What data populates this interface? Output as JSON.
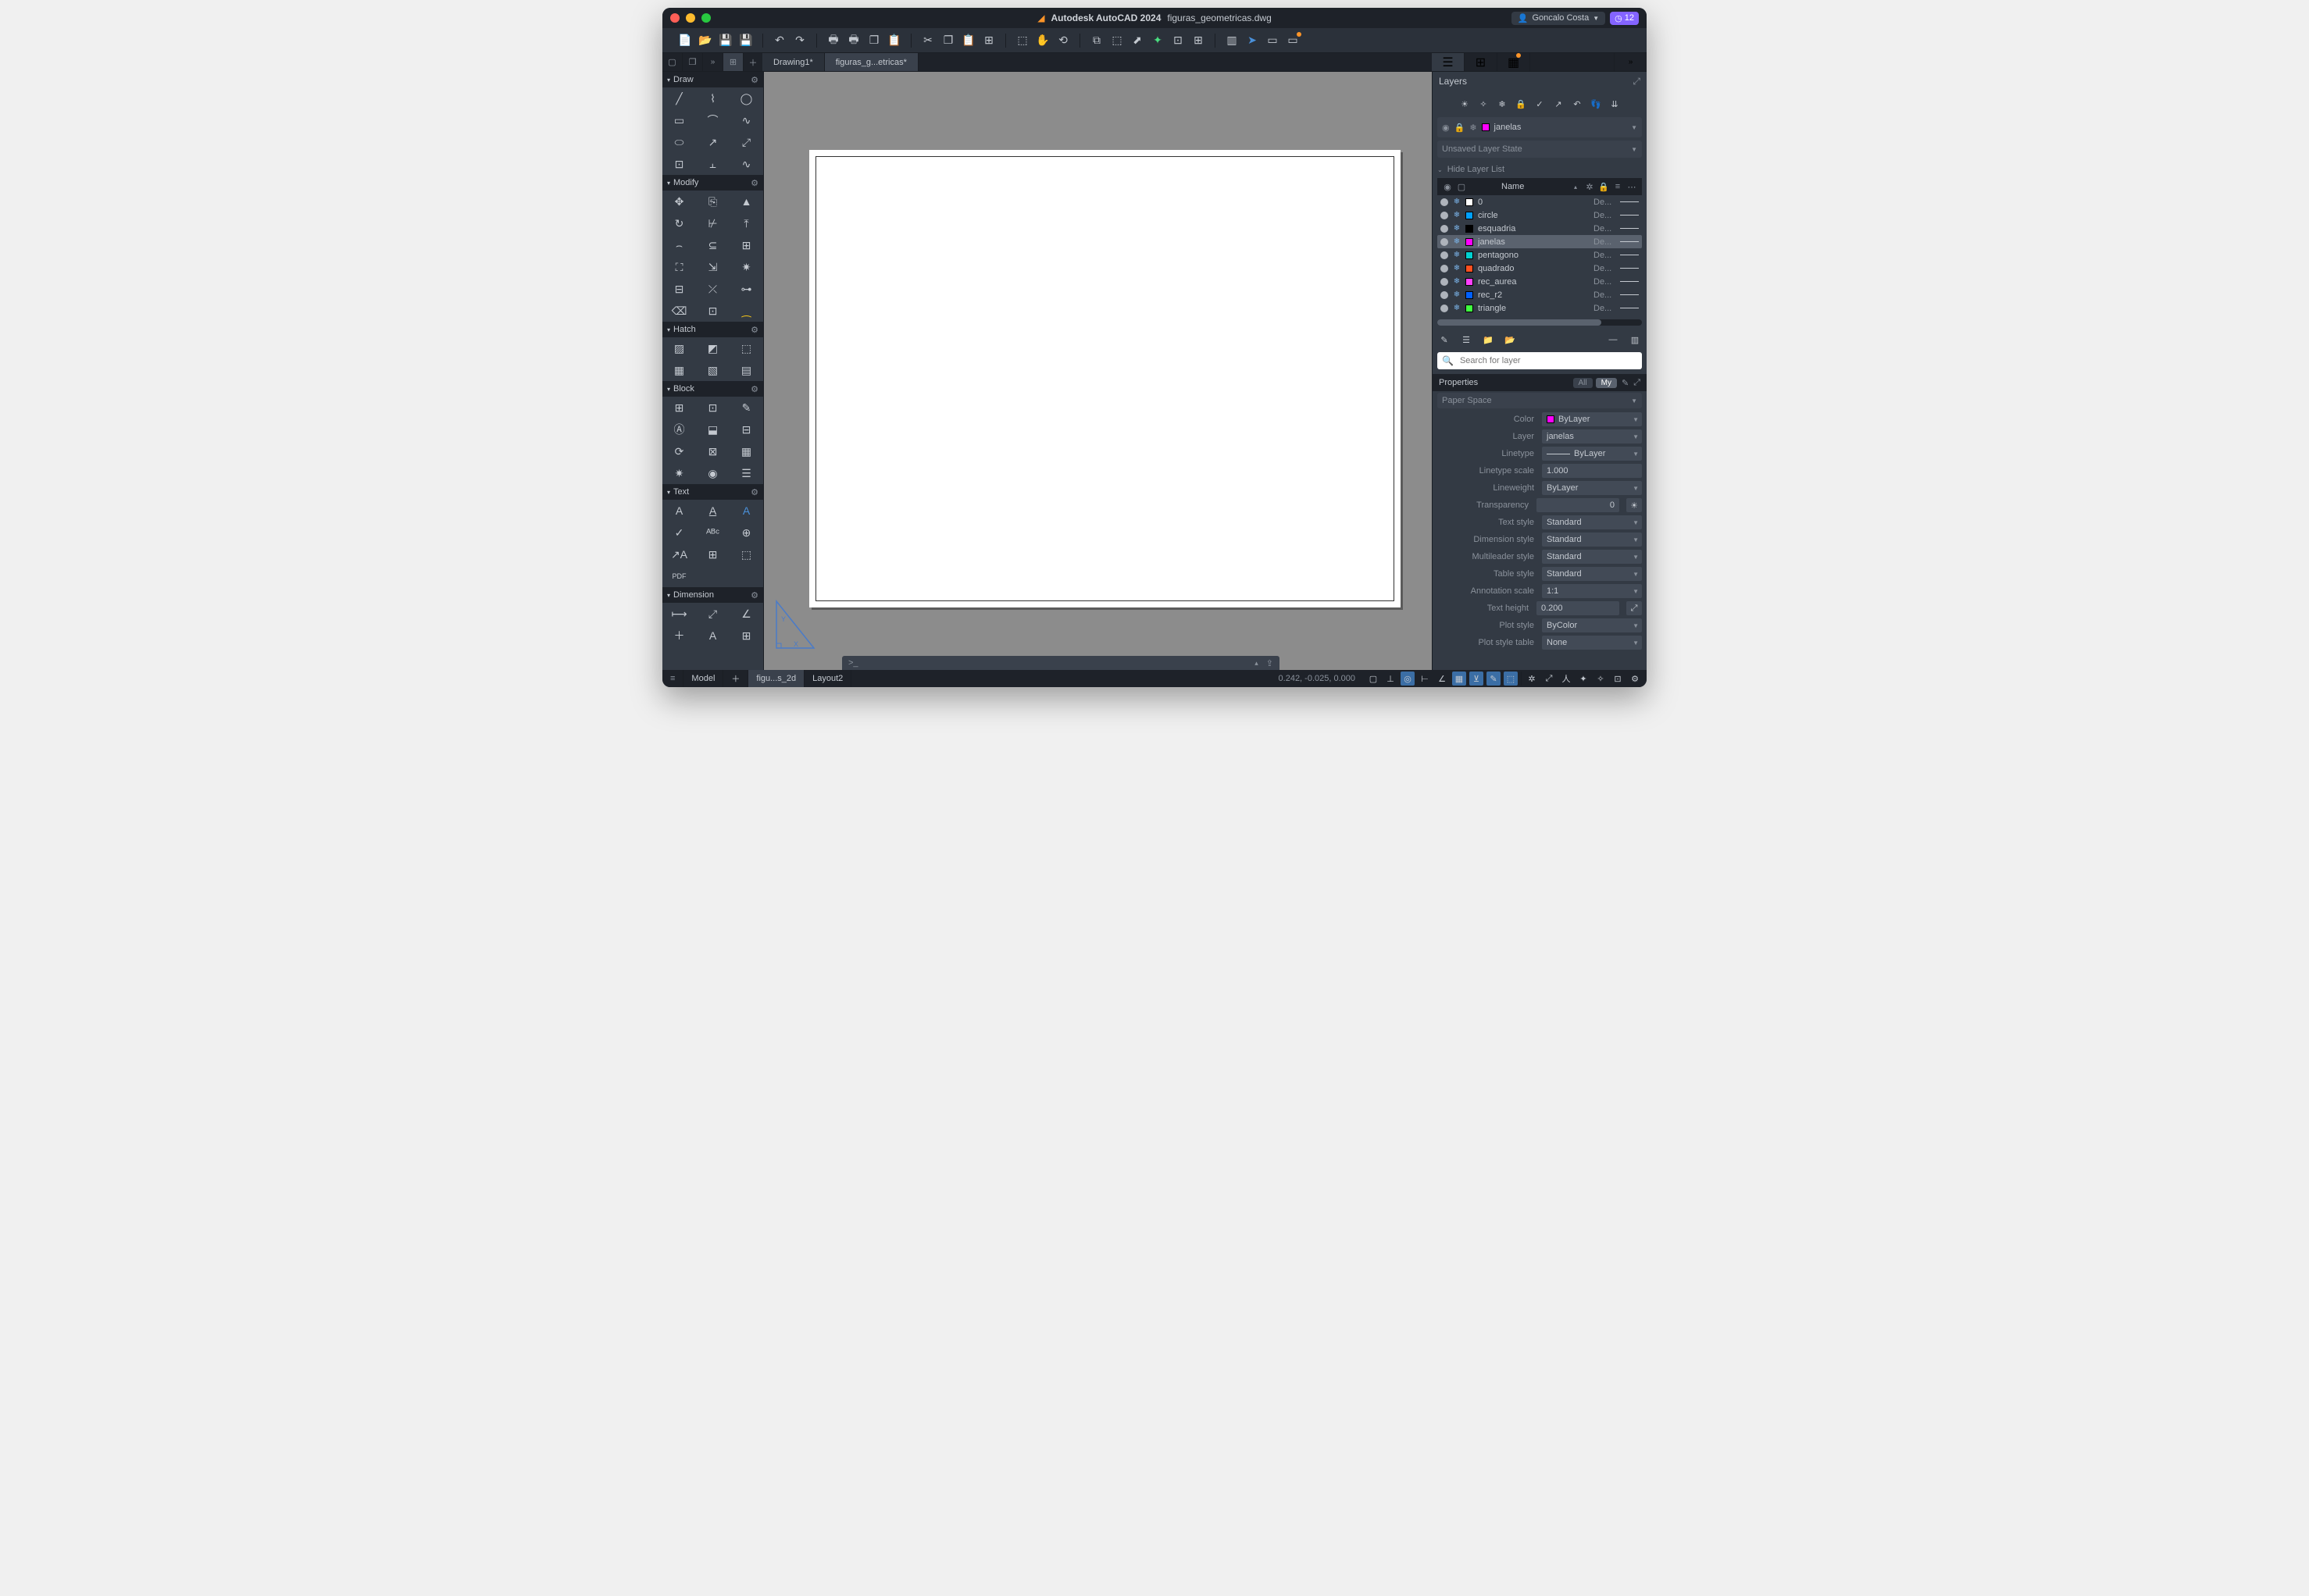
{
  "title": {
    "app": "Autodesk AutoCAD 2024",
    "doc": "figuras_geometricas.dwg"
  },
  "user": {
    "name": "Goncalo Costa",
    "badge": "12"
  },
  "doc_tabs": [
    {
      "label": "Drawing1*",
      "active": false
    },
    {
      "label": "figuras_g...etricas*",
      "active": true
    }
  ],
  "left_sections": [
    {
      "title": "Draw"
    },
    {
      "title": "Modify"
    },
    {
      "title": "Hatch"
    },
    {
      "title": "Block"
    },
    {
      "title": "Text"
    },
    {
      "title": "Dimension"
    }
  ],
  "layers": {
    "panel_title": "Layers",
    "current": "janelas",
    "current_color": "#ff00ff",
    "state": "Unsaved Layer State",
    "hide_label": "Hide Layer List",
    "header_name": "Name",
    "search_placeholder": "Search for layer",
    "items": [
      {
        "name": "0",
        "color": "#ffffff",
        "lt": "De..."
      },
      {
        "name": "circle",
        "color": "#00a0ff",
        "lt": "De..."
      },
      {
        "name": "esquadria",
        "color": "#000000",
        "lt": "De..."
      },
      {
        "name": "janelas",
        "color": "#ff00ff",
        "lt": "De...",
        "selected": true
      },
      {
        "name": "pentagono",
        "color": "#00d0d0",
        "lt": "De..."
      },
      {
        "name": "quadrado",
        "color": "#ff5020",
        "lt": "De..."
      },
      {
        "name": "rec_aurea",
        "color": "#ff40ff",
        "lt": "De..."
      },
      {
        "name": "rec_r2",
        "color": "#0060ff",
        "lt": "De..."
      },
      {
        "name": "triangle",
        "color": "#40ff40",
        "lt": "De..."
      }
    ]
  },
  "properties": {
    "title": "Properties",
    "pills": {
      "all": "All",
      "my": "My"
    },
    "space": "Paper Space",
    "rows": {
      "color": {
        "label": "Color",
        "value": "ByLayer",
        "swatch": "#ff00ff"
      },
      "layer": {
        "label": "Layer",
        "value": "janelas"
      },
      "linetype": {
        "label": "Linetype",
        "value": "ByLayer"
      },
      "linetype_scale": {
        "label": "Linetype scale",
        "value": "1.000"
      },
      "lineweight": {
        "label": "Lineweight",
        "value": "ByLayer"
      },
      "transparency": {
        "label": "Transparency",
        "value": "0"
      },
      "text_style": {
        "label": "Text style",
        "value": "Standard"
      },
      "dimension_style": {
        "label": "Dimension style",
        "value": "Standard"
      },
      "multileader_style": {
        "label": "Multileader style",
        "value": "Standard"
      },
      "table_style": {
        "label": "Table style",
        "value": "Standard"
      },
      "annotation_scale": {
        "label": "Annotation scale",
        "value": "1:1"
      },
      "text_height": {
        "label": "Text height",
        "value": "0.200"
      },
      "plot_style": {
        "label": "Plot style",
        "value": "ByColor"
      },
      "plot_style_table": {
        "label": "Plot style table",
        "value": "None"
      }
    }
  },
  "command": {
    "prompt": ">_"
  },
  "bottom": {
    "model": "Model",
    "layout1": "figu...s_2d",
    "layout2": "Layout2",
    "coords": "0.242,  -0.025, 0.000"
  }
}
